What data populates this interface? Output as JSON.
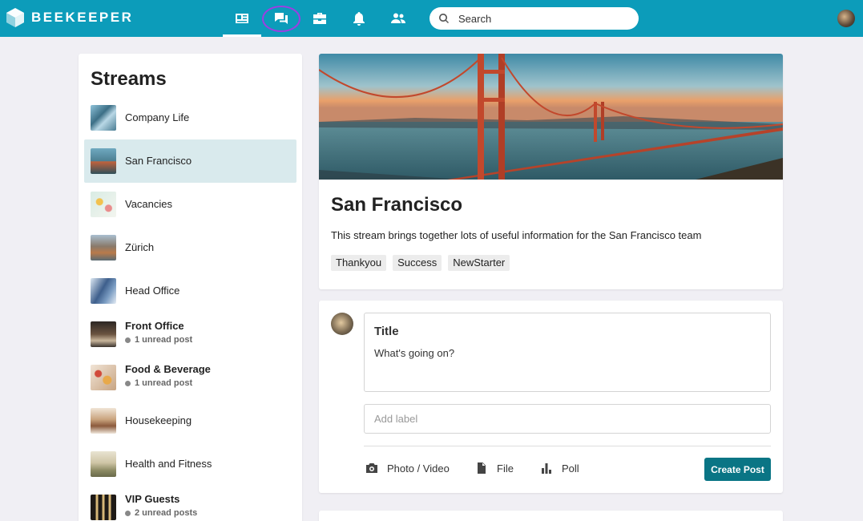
{
  "app": {
    "brand": "BEEKEEPER",
    "accent": "#0c9cba",
    "button_color": "#0a7585",
    "highlight_color": "#9b3fe2"
  },
  "topnav": {
    "items": [
      {
        "icon": "news-feed-icon",
        "active": true
      },
      {
        "icon": "chat-icon",
        "active": false,
        "highlighted": true
      },
      {
        "icon": "toolbox-icon",
        "active": false
      },
      {
        "icon": "bell-icon",
        "active": false
      },
      {
        "icon": "people-icon",
        "active": false
      }
    ],
    "search_placeholder": "Search"
  },
  "sidebar": {
    "title": "Streams",
    "items": [
      {
        "name": "Company Life",
        "unread": ""
      },
      {
        "name": "San Francisco",
        "unread": "",
        "selected": true
      },
      {
        "name": "Vacancies",
        "unread": ""
      },
      {
        "name": "Zürich",
        "unread": ""
      },
      {
        "name": "Head Office",
        "unread": ""
      },
      {
        "name": "Front Office",
        "unread": "1 unread post"
      },
      {
        "name": "Food & Beverage",
        "unread": "1 unread post"
      },
      {
        "name": "Housekeeping",
        "unread": ""
      },
      {
        "name": "Health and Fitness",
        "unread": ""
      },
      {
        "name": "VIP Guests",
        "unread": "2 unread posts"
      }
    ]
  },
  "stream": {
    "title": "San Francisco",
    "description": "This stream brings together lots of useful information for the San Francisco team",
    "tags": [
      "Thankyou",
      "Success",
      "NewStarter"
    ]
  },
  "composer": {
    "title_placeholder": "Title",
    "body_placeholder": "What's going on?",
    "label_placeholder": "Add label",
    "actions": {
      "photo": "Photo / Video",
      "file": "File",
      "poll": "Poll"
    },
    "submit": "Create Post"
  }
}
